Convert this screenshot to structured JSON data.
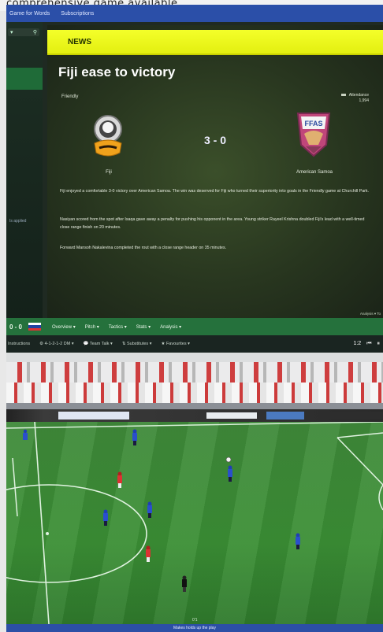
{
  "caption": "comprehensive game available",
  "top_window": {
    "menubar": {
      "items": [
        "Game for Words",
        "Subscriptions"
      ]
    },
    "sidebar": {
      "label": "Is applied"
    },
    "news": {
      "section_label": "NEWS",
      "headline": "Fiji ease to victory",
      "competition": "Friendly",
      "attendance_label": "Attendance",
      "attendance_value": "1,994",
      "home_team": "Fiji",
      "away_team": "American Samoa",
      "away_badge_text": "FFAS",
      "score": "3 - 0",
      "paragraphs": [
        "Fiji enjoyed a comfortable 3-0 victory over American Samoa. The win was deserved for Fiji who turned their superiority into goals in the Friendly game at Churchill Park.",
        "Nasiyan scored from the spot after Isaqa gave away a penalty for pushing his opponent in the area. Young striker Rayeel Krishna doubled Fiji's lead with a well-timed close range finish on 20 minutes.",
        "Forward Mansoh Nakalevina completed the rout with a close range header on 35 minutes."
      ],
      "status": "Analysis ▾  To"
    }
  },
  "bottom_window": {
    "score": "0 - 0",
    "menus": [
      "Overview ▾",
      "Pitch ▾",
      "Tactics ▾",
      "Stats ▾",
      "Analysis ▾"
    ],
    "toolbar": {
      "left_label": "Instructions",
      "formation": "4-1-2-1-2 DM ▾",
      "team_talk": "Team Talk ▾",
      "substitutes": "Substitutes ▾",
      "favourites": "Favourites ▾",
      "speed": "1:2",
      "rewind_icon": "rewind-icon",
      "pause_icon": "pause-icon"
    },
    "minute": "0'1",
    "status_bar": "Makes holds up the play"
  }
}
